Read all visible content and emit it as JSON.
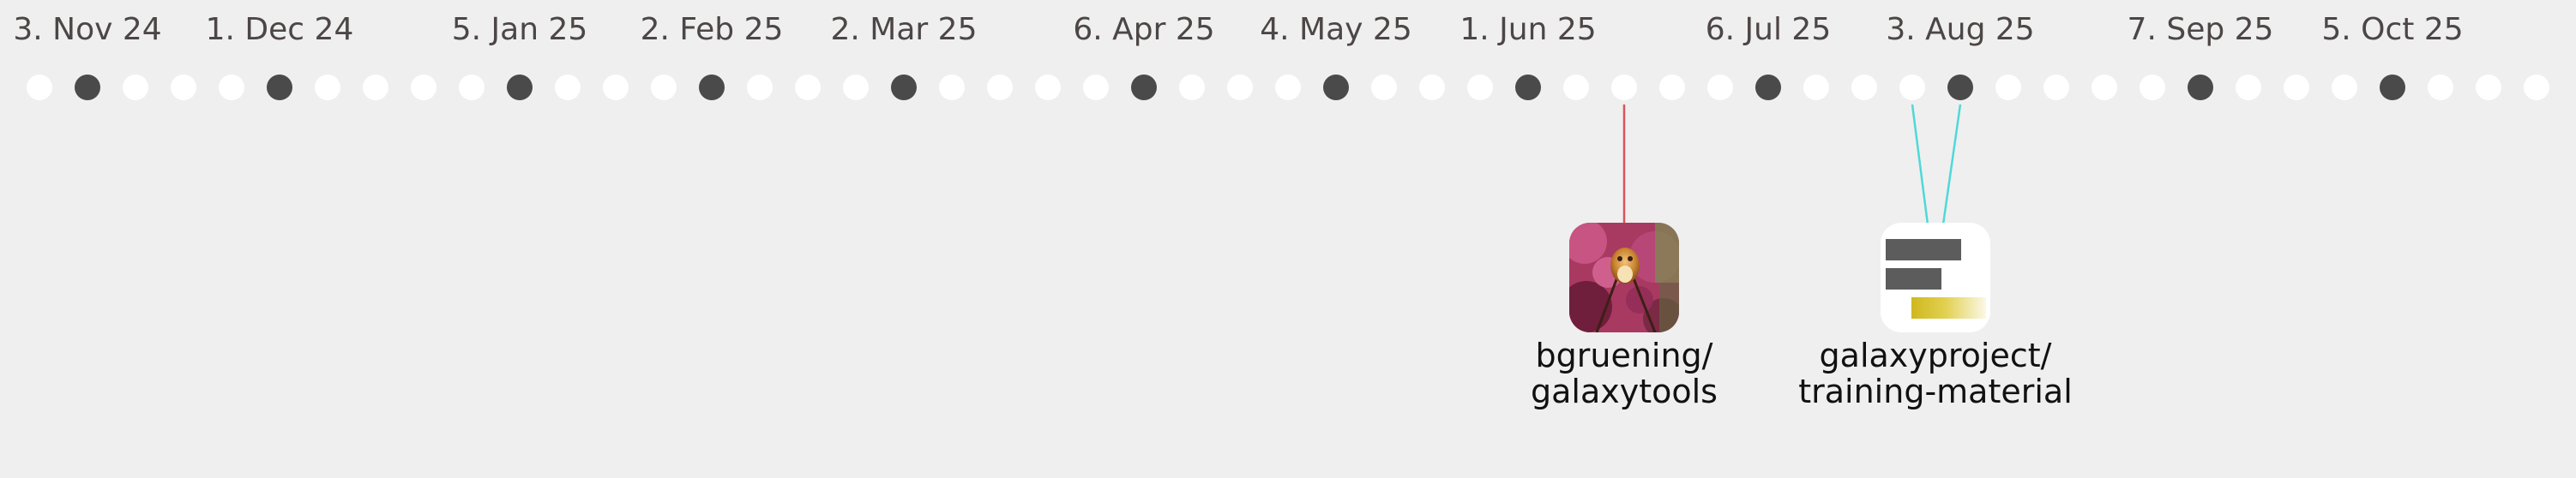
{
  "timeline": {
    "week_count": 53,
    "month_labels": [
      {
        "text": "3. Nov 24",
        "week": 1
      },
      {
        "text": "1. Dec 24",
        "week": 5
      },
      {
        "text": "5. Jan 25",
        "week": 10
      },
      {
        "text": "2. Feb 25",
        "week": 14
      },
      {
        "text": "2. Mar 25",
        "week": 18
      },
      {
        "text": "6. Apr 25",
        "week": 23
      },
      {
        "text": "4. May 25",
        "week": 27
      },
      {
        "text": "1. Jun 25",
        "week": 31
      },
      {
        "text": "6. Jul 25",
        "week": 36
      },
      {
        "text": "3. Aug 25",
        "week": 40
      },
      {
        "text": "7. Sep 25",
        "week": 45
      },
      {
        "text": "5. Oct 25",
        "week": 49
      }
    ],
    "colors": {
      "background": "#efefef",
      "week_dot": "#ffffff",
      "month_start_dot": "#4a4a4a",
      "label": "#4d4646",
      "repo_name": "#111111"
    }
  },
  "repos": [
    {
      "owner": "bgruening/",
      "name": "galaxytools",
      "icon": "orchid-photo-icon",
      "link_color": "#d9535f",
      "linked_weeks": [
        33
      ]
    },
    {
      "owner": "galaxyproject/",
      "name": "training-material",
      "icon": "training-bars-icon",
      "link_color": "#4fd8d8",
      "linked_weeks": [
        39,
        40
      ]
    }
  ]
}
